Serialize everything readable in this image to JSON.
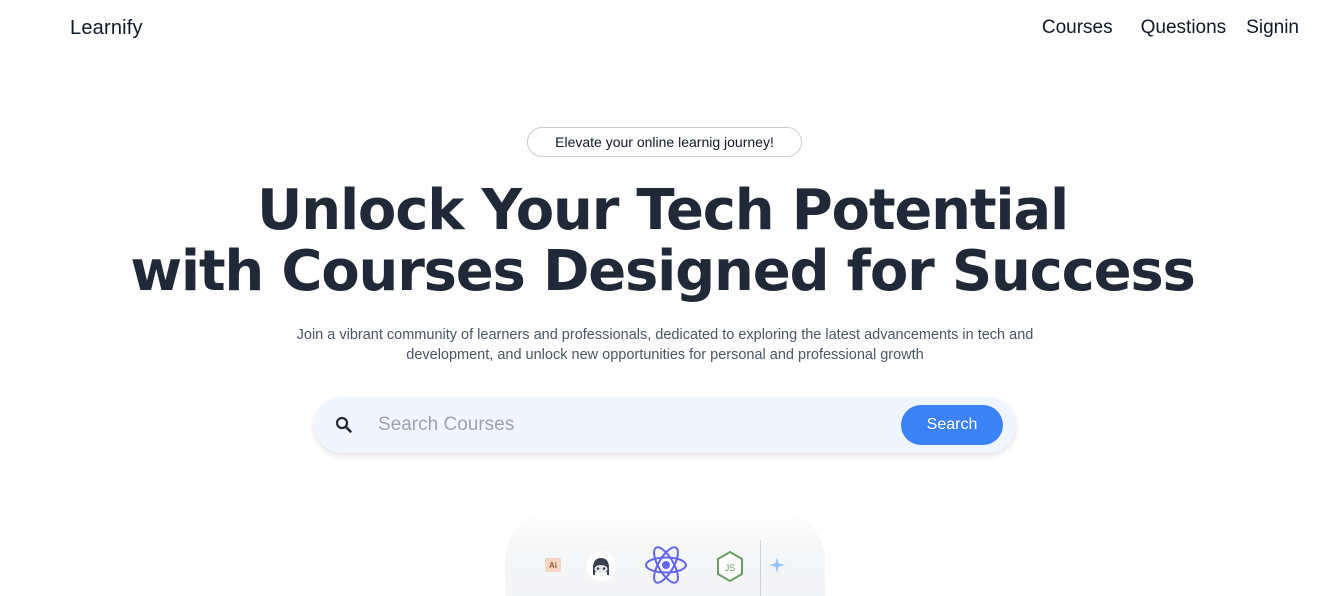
{
  "nav": {
    "logo": "Learnify",
    "links": [
      "Courses",
      "Questions",
      "Signin"
    ]
  },
  "hero": {
    "badge": "Elevate your online learnig journey!",
    "title_line1": "Unlock Your Tech Potential",
    "title_line2": "with Courses Designed for Success",
    "subtitle_line1": "Join a vibrant community of learners and professionals, dedicated to exploring the latest advancements in tech and",
    "subtitle_line2": "development, and unlock new opportunities for personal and professional growth"
  },
  "search": {
    "placeholder": "Search Courses",
    "value": "",
    "button_label": "Search",
    "icon": "search-icon"
  },
  "tech_icons": {
    "ai_label": "Ai",
    "items": [
      "adobe-illustrator-icon",
      "github-icon",
      "react-icon",
      "nodejs-icon",
      "sparkle-icon"
    ]
  },
  "colors": {
    "accent": "#3b82f6",
    "title": "#1f2937",
    "search_bg": "#eff6ff",
    "react": "#6366f1",
    "node": "#68a063"
  }
}
